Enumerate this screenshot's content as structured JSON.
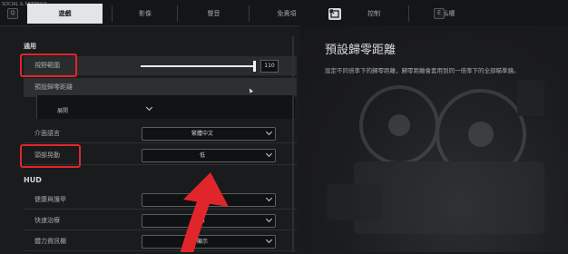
{
  "breadcrumb": "SOCIAL & SETTINGS",
  "nav_keys": {
    "left": "Q",
    "right": "E"
  },
  "tabs": [
    {
      "label": "遊戲",
      "active": true
    },
    {
      "label": "影像",
      "active": false
    },
    {
      "label": "聲音",
      "active": false
    },
    {
      "label": "免責項",
      "active": false
    },
    {
      "label": "控制",
      "active": false
    },
    {
      "label": "隱私權",
      "active": false
    }
  ],
  "sections": {
    "general": "通用",
    "hud": "HUD"
  },
  "fov": {
    "label": "視野範圍",
    "value": "110",
    "fraction": 1.0
  },
  "zeroing": {
    "label": "預設歸零距離",
    "sub_label": "展開"
  },
  "language": {
    "label": "介面語言",
    "value": "繁體中文"
  },
  "head_bob": {
    "label": "頭部晃動",
    "value": "低"
  },
  "hud_rows": [
    {
      "label": "健康與護甲",
      "value": "自"
    },
    {
      "label": "快速治療",
      "value": "自"
    },
    {
      "label": "體力資訊欄",
      "value": "顯示"
    }
  ],
  "detail": {
    "title": "預設歸零距離",
    "description": "設定不同倍率下的歸零距離，歸零距離會套用到同一倍率下的全部瞄準鏡。"
  },
  "colors": {
    "highlight_box": "#e0262b",
    "arrow": "#e0262b"
  }
}
